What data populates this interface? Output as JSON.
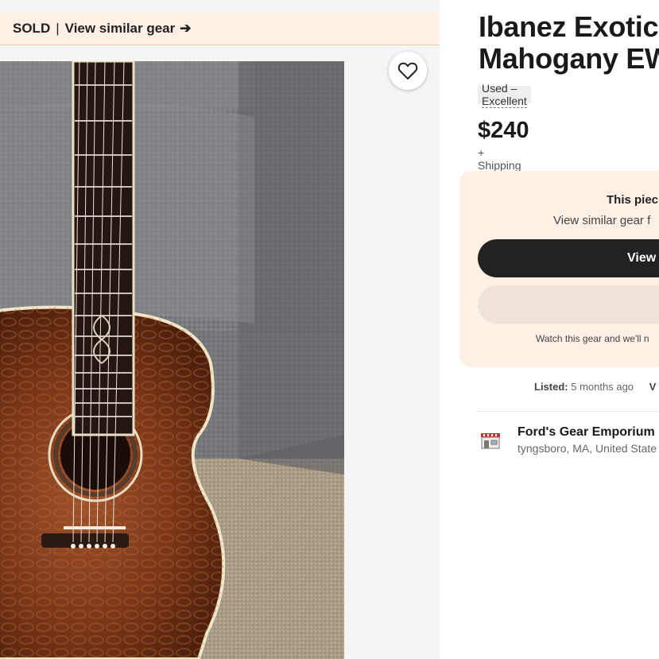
{
  "banner": {
    "sold": "SOLD",
    "separator": "|",
    "link": "View similar gear",
    "arrow": "➔"
  },
  "listing": {
    "title_line1": "Ibanez Exotic",
    "title_line2": "Mahogany EW",
    "condition": "Used – Excellent",
    "price": "$240",
    "shipping": "+ Shipping"
  },
  "sold_panel": {
    "heading": "This piec",
    "subheading": "View similar gear f",
    "view_button": "View",
    "watch_note": "Watch this gear and we'll n"
  },
  "meta": {
    "listed_label": "Listed:",
    "listed_value": "5 months ago",
    "more": "V"
  },
  "shop": {
    "name": "Ford's Gear Emporium",
    "location": "tyngsboro, MA, United State"
  },
  "colors": {
    "banner_bg": "#fff0e6",
    "button_dark": "#222222",
    "wood": "#8a3f1c"
  },
  "icons": {
    "favorite": "heart-icon",
    "shop": "storefront-icon"
  }
}
